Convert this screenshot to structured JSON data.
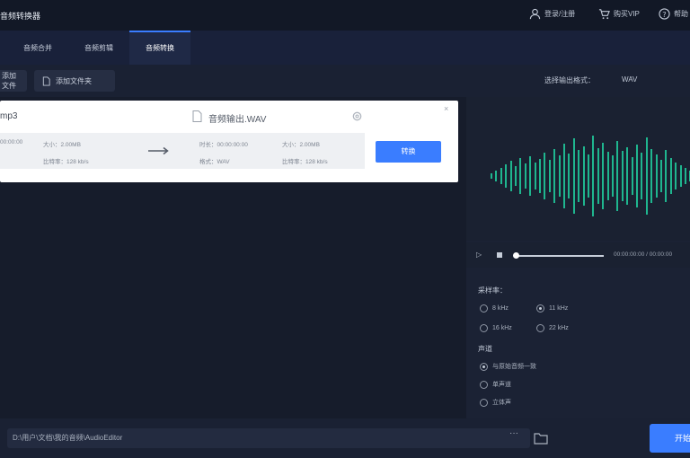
{
  "app": {
    "title": "音频转换器"
  },
  "topbar": {
    "login_label": "登录/注册",
    "vip_label": "购买VIP",
    "help_label": "帮助"
  },
  "tabs": [
    {
      "label": "音频合并"
    },
    {
      "label": "音频剪辑"
    },
    {
      "label": "音频转换",
      "active": true
    }
  ],
  "toolbar": {
    "add_file_label": "添加文件",
    "add_folder_label": "添加文件夹",
    "output_format_label": "选择输出格式：",
    "output_format_value": "WAV"
  },
  "file_card": {
    "name": "mp3",
    "output_name": "音频输出.WAV",
    "src_duration": "00:00:00",
    "src_size": "大小：2.00MB",
    "src_bitrate": "比特率：128 kb/s",
    "dst_duration": "时长：00:00:00:00",
    "dst_size": "大小：2.00MB",
    "dst_format": "格式：WAV",
    "dst_bitrate": "比特率：128 kb/s",
    "convert_label": "转换",
    "close_label": "×"
  },
  "player": {
    "time": "00:00:00:00 / 00:00:00"
  },
  "settings": {
    "samplerate_title": "采样率：",
    "samplerate_options": [
      {
        "label": "8 kHz",
        "checked": false
      },
      {
        "label": "11 kHz",
        "checked": true
      },
      {
        "label": "16 kHz",
        "checked": false
      },
      {
        "label": "22 kHz",
        "checked": false
      }
    ],
    "channel_title": "声道",
    "channel_options": [
      {
        "label": "与原始音频一致",
        "checked": true
      },
      {
        "label": "单声道",
        "checked": false
      },
      {
        "label": "立体声",
        "checked": false
      }
    ]
  },
  "footer": {
    "output_path": "D:\\用户\\文档\\我的音频\\AudioEditor",
    "more_label": "···",
    "start_label": "开始"
  },
  "colors": {
    "accent": "#3a7dff",
    "wave": "#1fb68f",
    "background": "#161c2b",
    "card": "#ffffff"
  },
  "icons": [
    "user-icon",
    "cart-icon",
    "help-icon",
    "file-icon",
    "folder-icon",
    "gear-icon",
    "arrow-right-icon",
    "play-icon",
    "stop-icon"
  ]
}
